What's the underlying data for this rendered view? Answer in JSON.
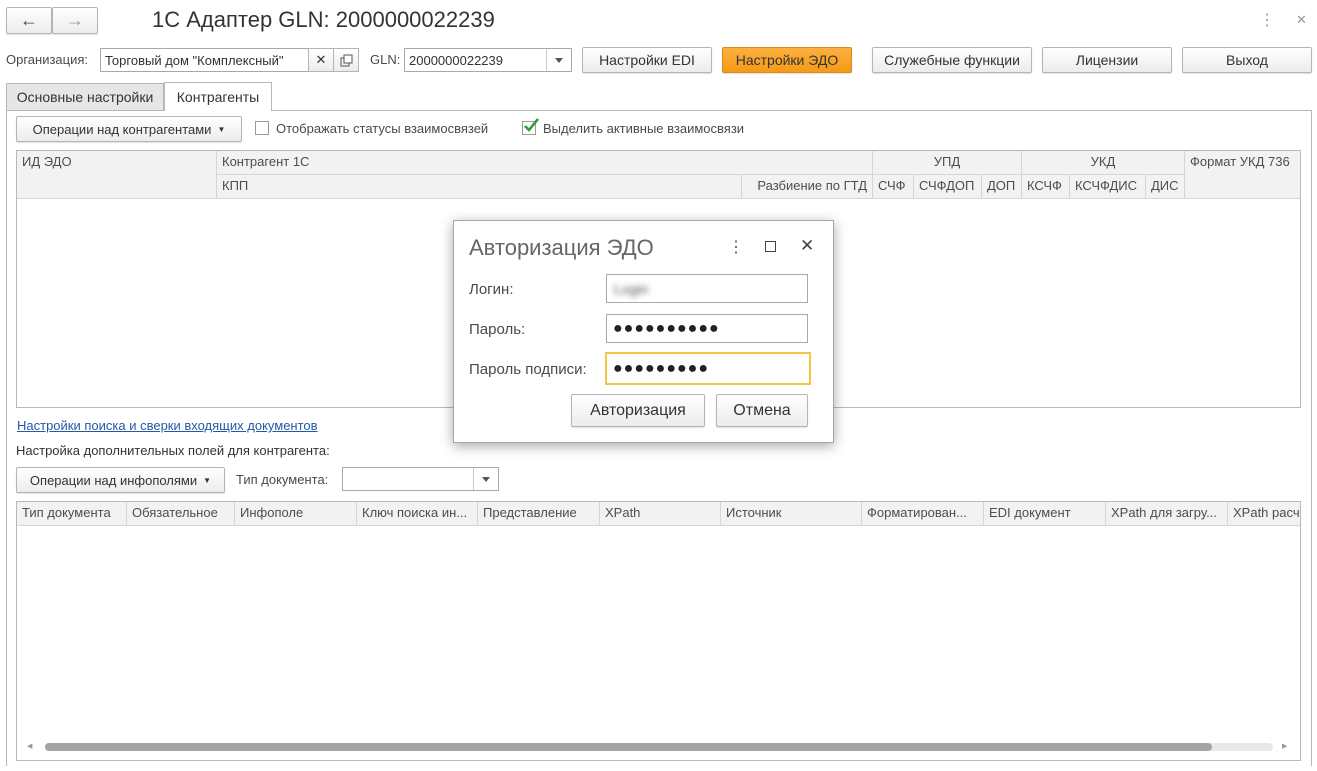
{
  "window": {
    "title": "1С Адаптер GLN: 2000000022239",
    "nav_back": "←",
    "nav_forward": "→",
    "more_icon": "⋮",
    "close_icon": "✕"
  },
  "toolbar": {
    "org_label": "Организация:",
    "org_value": "Торговый дом \"Комплексный\"",
    "gln_label": "GLN:",
    "gln_value": "2000000022239",
    "edi_settings": "Настройки EDI",
    "edo_settings": "Настройки ЭДО",
    "service_functions": "Служебные функции",
    "licenses": "Лицензии",
    "exit": "Выход"
  },
  "tabs": [
    {
      "label": "Основные настройки",
      "active": false
    },
    {
      "label": "Контрагенты",
      "active": true
    }
  ],
  "counterparties": {
    "ops_button": "Операции над контрагентами",
    "show_statuses_label": "Отображать статусы взаимосвязей",
    "show_statuses_checked": false,
    "highlight_active_label": "Выделить активные взаимосвязи",
    "highlight_active_checked": true,
    "columns": {
      "id_edo": "ИД ЭДО",
      "counterparty_1c": "Контрагент 1С",
      "kpp": "КПП",
      "gtd_split": "Разбиение по ГТД",
      "upd": "УПД",
      "upd_sf": "СЧФ",
      "upd_sfdop": "СЧФДОП",
      "upd_dop": "ДОП",
      "ukd": "УКД",
      "ukd_ksf": "КСЧФ",
      "ukd_ksfdis": "КСЧФДИС",
      "ukd_dis": "ДИС",
      "ukd_format": "Формат УКД 736"
    }
  },
  "search_settings_link": "Настройки поиска и сверки входящих документов",
  "extra_fields": {
    "heading": "Настройка дополнительных полей для контрагента:",
    "ops_button": "Операции над инфополями",
    "doc_type_label": "Тип документа:",
    "doc_type_value": "",
    "columns": [
      "Тип документа",
      "Обязательное",
      "Инфополе",
      "Ключ поиска ин...",
      "Представление",
      "XPath",
      "Источник",
      "Форматирован...",
      "EDI документ",
      "XPath для загру...",
      "XPath расч"
    ]
  },
  "dialog": {
    "title": "Авторизация ЭДО",
    "login_label": "Логин:",
    "login_value": "Login",
    "password_label": "Пароль:",
    "password_value": "●●●●●●●●●●",
    "sign_password_label": "Пароль подписи:",
    "sign_password_value": "●●●●●●●●●",
    "authorize_button": "Авторизация",
    "cancel_button": "Отмена"
  },
  "colors": {
    "accent": "#f59a16",
    "link": "#2459a8",
    "check": "#2e9d3a"
  }
}
